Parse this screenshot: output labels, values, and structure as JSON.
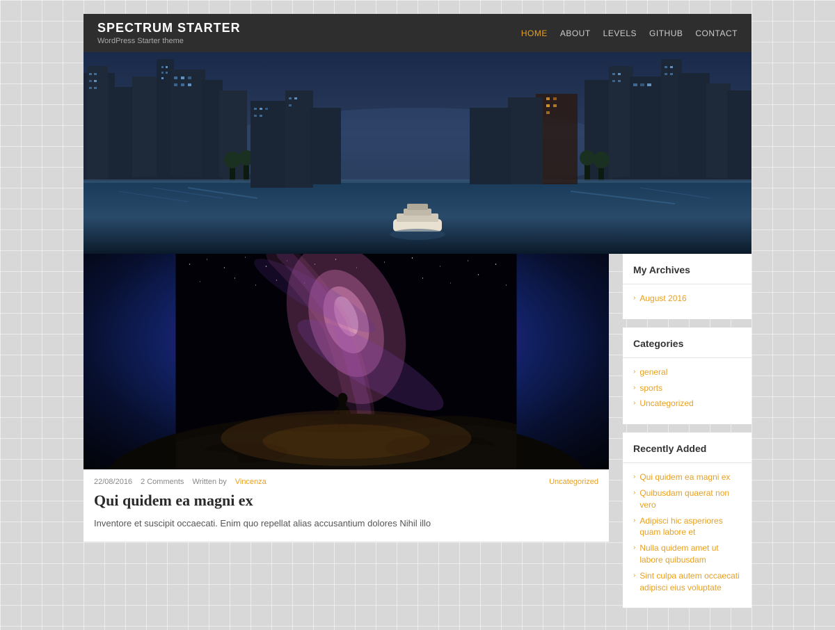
{
  "site": {
    "title": "SPECTRUM STARTER",
    "description": "WordPress Starter theme"
  },
  "nav": {
    "items": [
      {
        "label": "HOME",
        "active": true
      },
      {
        "label": "ABOUT",
        "active": false
      },
      {
        "label": "LEVELS",
        "active": false
      },
      {
        "label": "GITHUB",
        "active": false
      },
      {
        "label": "CONTACT",
        "active": false
      }
    ]
  },
  "article": {
    "date": "22/08/2016",
    "comments": "2 Comments",
    "written_by": "Written by",
    "author": "Vincenza",
    "category": "Uncategorized",
    "title": "Qui quidem ea magni ex",
    "excerpt": "Inventore et suscipit occaecati. Enim quo repellat alias accusantium dolores Nihil illo"
  },
  "sidebar": {
    "archives": {
      "title": "My Archives",
      "items": [
        {
          "label": "August 2016"
        }
      ]
    },
    "categories": {
      "title": "Categories",
      "items": [
        {
          "label": "general"
        },
        {
          "label": "sports"
        },
        {
          "label": "Uncategorized"
        }
      ]
    },
    "recently_added": {
      "title": "Recently Added",
      "items": [
        {
          "label": "Qui quidem ea magni ex"
        },
        {
          "label": "Quibusdam quaerat non vero"
        },
        {
          "label": "Adipisci hic asperiores quam labore et"
        },
        {
          "label": "Nulla quidem amet ut labore quibusdam"
        },
        {
          "label": "Sint culpa autem occaecati adipisci eius voluptate"
        }
      ]
    }
  }
}
